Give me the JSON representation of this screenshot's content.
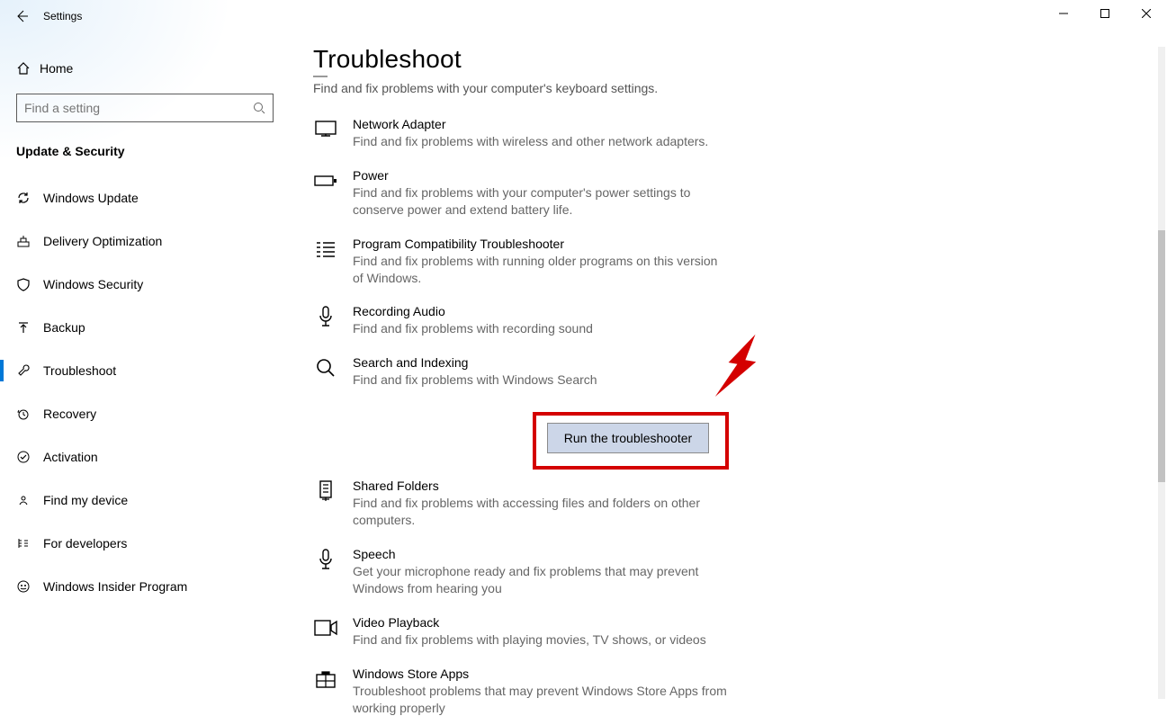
{
  "window": {
    "title": "Settings"
  },
  "sidebar": {
    "home_label": "Home",
    "search_placeholder": "Find a setting",
    "section_title": "Update & Security",
    "items": [
      {
        "label": "Windows Update"
      },
      {
        "label": "Delivery Optimization"
      },
      {
        "label": "Windows Security"
      },
      {
        "label": "Backup"
      },
      {
        "label": "Troubleshoot"
      },
      {
        "label": "Recovery"
      },
      {
        "label": "Activation"
      },
      {
        "label": "Find my device"
      },
      {
        "label": "For developers"
      },
      {
        "label": "Windows Insider Program"
      }
    ]
  },
  "main": {
    "title": "Troubleshoot",
    "top_desc": "Find and fix problems with your computer's keyboard settings.",
    "run_label": "Run the troubleshooter",
    "tiles": [
      {
        "title": "Network Adapter",
        "desc": "Find and fix problems with wireless and other network adapters."
      },
      {
        "title": "Power",
        "desc": "Find and fix problems with your computer's power settings to conserve power and extend battery life."
      },
      {
        "title": "Program Compatibility Troubleshooter",
        "desc": "Find and fix problems with running older programs on this version of Windows."
      },
      {
        "title": "Recording Audio",
        "desc": "Find and fix problems with recording sound"
      },
      {
        "title": "Search and Indexing",
        "desc": "Find and fix problems with Windows Search"
      },
      {
        "title": "Shared Folders",
        "desc": "Find and fix problems with accessing files and folders on other computers."
      },
      {
        "title": "Speech",
        "desc": "Get your microphone ready and fix problems that may prevent Windows from hearing you"
      },
      {
        "title": "Video Playback",
        "desc": "Find and fix problems with playing movies, TV shows, or videos"
      },
      {
        "title": "Windows Store Apps",
        "desc": "Troubleshoot problems that may prevent Windows Store Apps from working properly"
      }
    ]
  }
}
